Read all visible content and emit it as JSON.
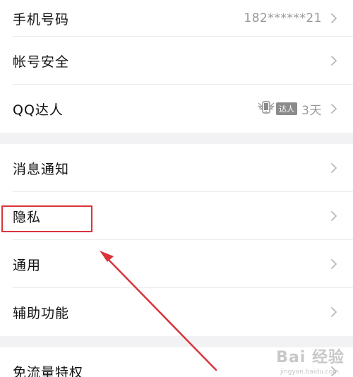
{
  "settings": {
    "group1": {
      "phone": {
        "label": "手机号码",
        "value": "182******21"
      },
      "account_security": {
        "label": "帐号安全"
      },
      "qq_master": {
        "label": "QQ达人",
        "badge": "达人",
        "days": "3天"
      }
    },
    "group2": {
      "notifications": {
        "label": "消息通知"
      },
      "privacy": {
        "label": "隐私"
      },
      "general": {
        "label": "通用"
      },
      "accessibility": {
        "label": "辅助功能"
      }
    },
    "group3": {
      "free_data": {
        "label": "免流量特权"
      }
    }
  },
  "annotation": {
    "highlight_color": "#d9343a",
    "arrow_color": "#d9343a"
  },
  "watermark": {
    "text": "Bai 经验",
    "sub": "jingyan.baidu.com"
  },
  "colors": {
    "label": "#111111",
    "value": "#999999",
    "separator": "#f2f2f4"
  }
}
